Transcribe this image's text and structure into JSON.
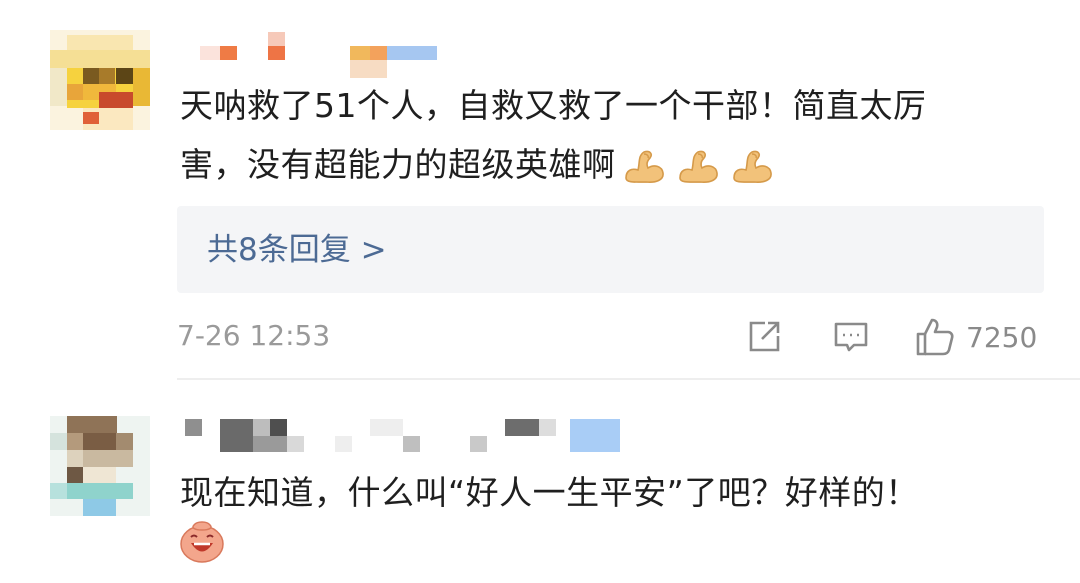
{
  "comments": [
    {
      "text_line1": "天呐救了51个人，自救又救了一个干部！简直太厉",
      "text_line2": "害，没有超能力的超级英雄啊",
      "inline_emojis": [
        "flexed-biceps-icon",
        "flexed-biceps-icon",
        "flexed-biceps-icon"
      ],
      "replies_link": "共8条回复 >",
      "timestamp": "7-26 12:53",
      "like_count": "7250"
    },
    {
      "text": "现在知道，什么叫“好人一生平安”了吧？好样的！",
      "inline_emojis": [
        "laughing-face-icon"
      ]
    }
  ],
  "icons": {
    "share": "share-icon",
    "comment": "comment-icon",
    "like": "thumbs-up-icon"
  },
  "colors": {
    "link": "#4c6a94",
    "meta": "#9a9a9a",
    "reply_box_bg": "#f4f5f7"
  }
}
